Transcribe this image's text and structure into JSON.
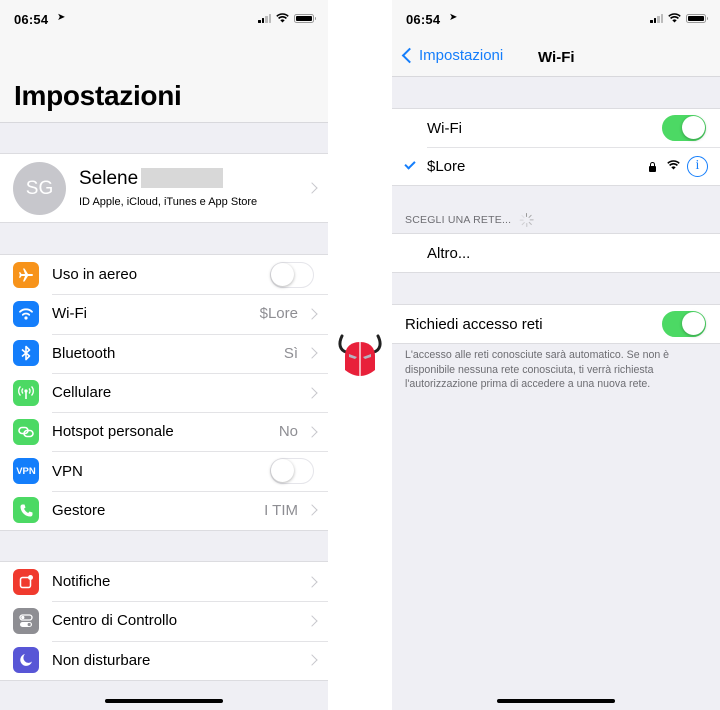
{
  "left": {
    "status_bar": {
      "time": "06:54"
    },
    "title": "Impostazioni",
    "profile": {
      "initials": "SG",
      "name": "Selene",
      "subtitle": "ID Apple, iCloud, iTunes e App Store"
    },
    "group1": [
      {
        "label": "Uso in aereo",
        "icon": "airplane-icon",
        "color": "#f7931a",
        "toggle": false
      },
      {
        "label": "Wi-Fi",
        "icon": "wifi-icon",
        "color": "#147efb",
        "value": "$Lore"
      },
      {
        "label": "Bluetooth",
        "icon": "bluetooth-icon",
        "color": "#147efb",
        "value": "Sì"
      },
      {
        "label": "Cellulare",
        "icon": "cellular-icon",
        "color": "#4cd964",
        "value": ""
      },
      {
        "label": "Hotspot personale",
        "icon": "hotspot-icon",
        "color": "#4cd964",
        "value": "No"
      },
      {
        "label": "VPN",
        "icon": "vpn-icon",
        "icon_text": "VPN",
        "color": "#147efb",
        "toggle": false
      },
      {
        "label": "Gestore",
        "icon": "phone-icon",
        "color": "#4cd964",
        "value": "I TIM"
      }
    ],
    "group2": [
      {
        "label": "Notifiche",
        "icon": "notifications-icon",
        "color": "#f03a2e"
      },
      {
        "label": "Centro di Controllo",
        "icon": "control-center-icon",
        "color": "#8e8e93"
      },
      {
        "label": "Non disturbare",
        "icon": "moon-icon",
        "color": "#5856d6"
      }
    ]
  },
  "right": {
    "status_bar": {
      "time": "06:54"
    },
    "nav": {
      "back_label": "Impostazioni",
      "title": "Wi-Fi"
    },
    "wifi_toggle": {
      "label": "Wi-Fi",
      "on": true
    },
    "connected_network": {
      "name": "$Lore",
      "secured": true,
      "info_symbol": "i"
    },
    "section_header": "SCEGLI UNA RETE...",
    "other_label": "Altro...",
    "ask_join": {
      "label": "Richiedi accesso reti",
      "on": true
    },
    "footer": "L'accesso alle reti conosciute sarà automatico. Se non è disponibile nessuna rete conosciuta, ti verrà richiesta l'autorizzazione prima di accedere a una nuova rete."
  },
  "colors": {
    "accent": "#157efb",
    "toggle_on": "#4cd964",
    "background": "#efeff4"
  }
}
